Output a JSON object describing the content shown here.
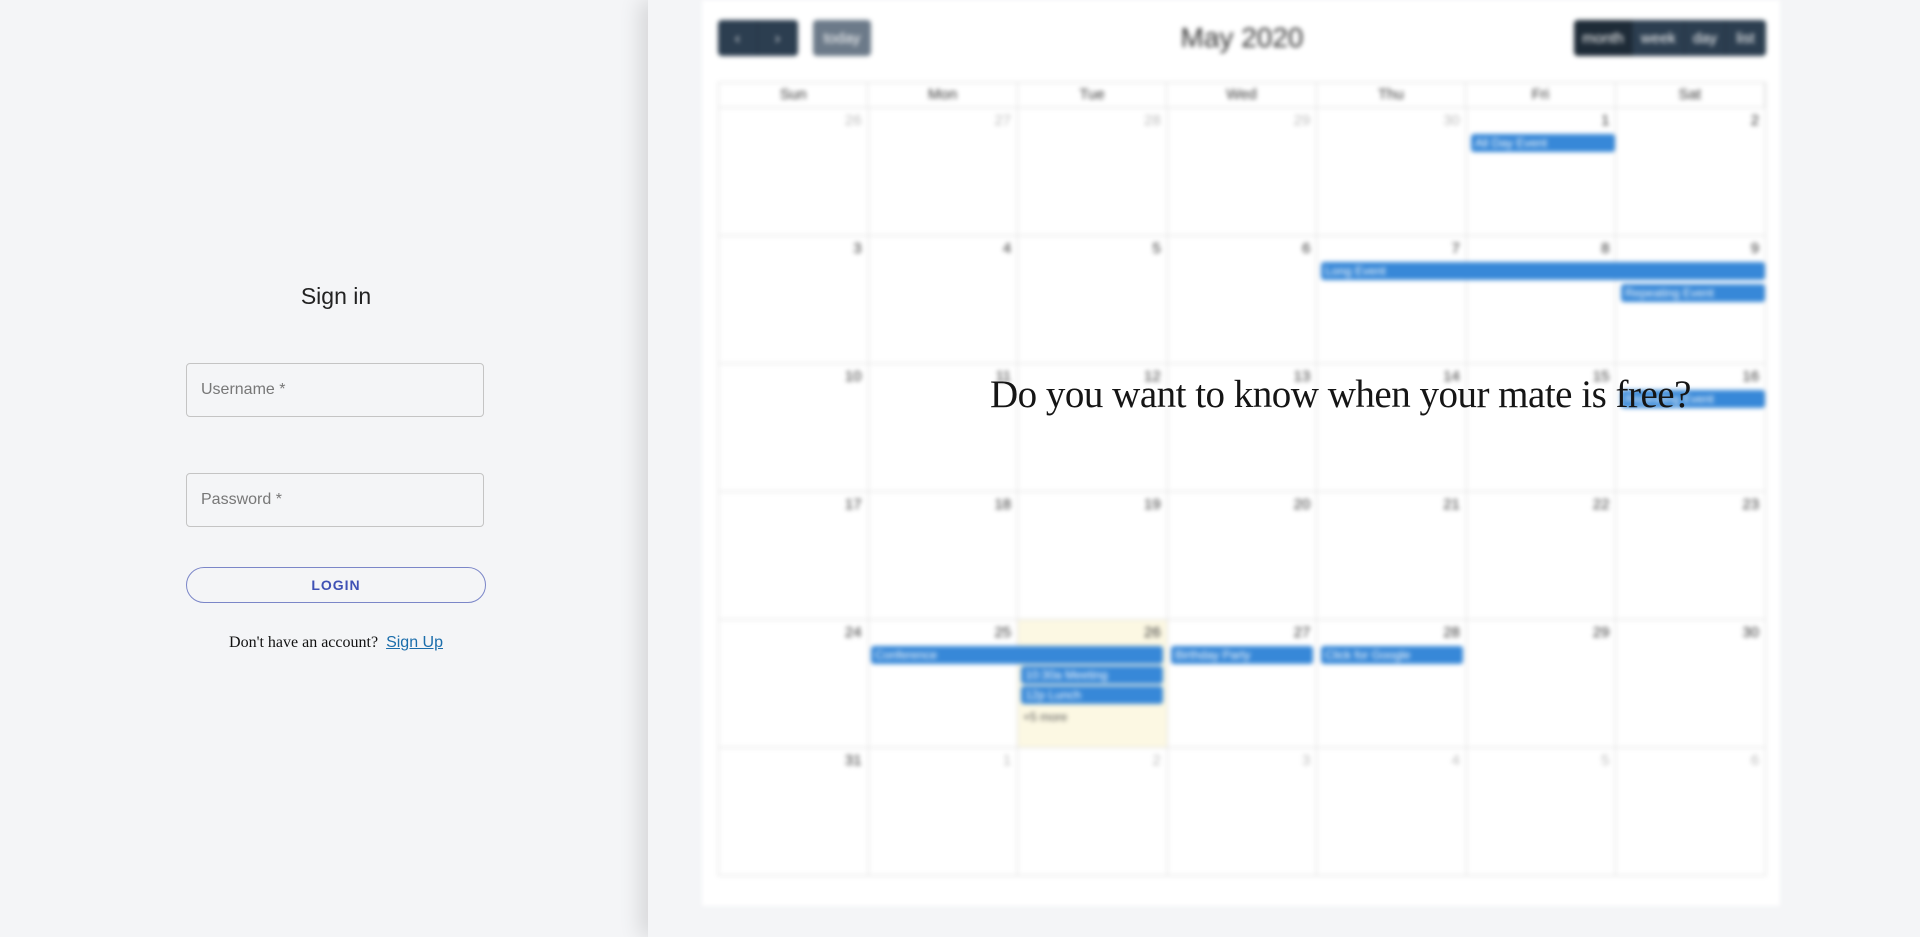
{
  "signin": {
    "title": "Sign in",
    "username_placeholder": "Username *",
    "password_placeholder": "Password *",
    "login_label": "LOGIN",
    "no_account_text": "Don't have an account?",
    "signup_label": "Sign Up"
  },
  "tagline": "Do you want to know when your mate is free?",
  "calendar": {
    "prev_label": "‹",
    "next_label": "›",
    "today_label": "today",
    "title": "May 2020",
    "views": [
      "month",
      "week",
      "day",
      "list"
    ],
    "dow": [
      "Sun",
      "Mon",
      "Tue",
      "Wed",
      "Thu",
      "Fri",
      "Sat"
    ],
    "weeks": [
      [
        "26",
        "27",
        "28",
        "29",
        "30",
        "1",
        "2"
      ],
      [
        "3",
        "4",
        "5",
        "6",
        "7",
        "8",
        "9"
      ],
      [
        "10",
        "11",
        "12",
        "13",
        "14",
        "15",
        "16"
      ],
      [
        "17",
        "18",
        "19",
        "20",
        "21",
        "22",
        "23"
      ],
      [
        "24",
        "25",
        "26",
        "27",
        "28",
        "29",
        "30"
      ],
      [
        "31",
        "1",
        "2",
        "3",
        "4",
        "5",
        "6"
      ]
    ],
    "events": {
      "all_day": "All Day Event",
      "long": "Long Event",
      "repeat1": "Repeating Event",
      "repeat2": "Repeating Event",
      "conference": "Conference",
      "meeting": "10:30a Meeting",
      "lunch": "12p Lunch",
      "more": "+5 more",
      "birthday": "Birthday Party",
      "click": "Click for Google"
    }
  }
}
